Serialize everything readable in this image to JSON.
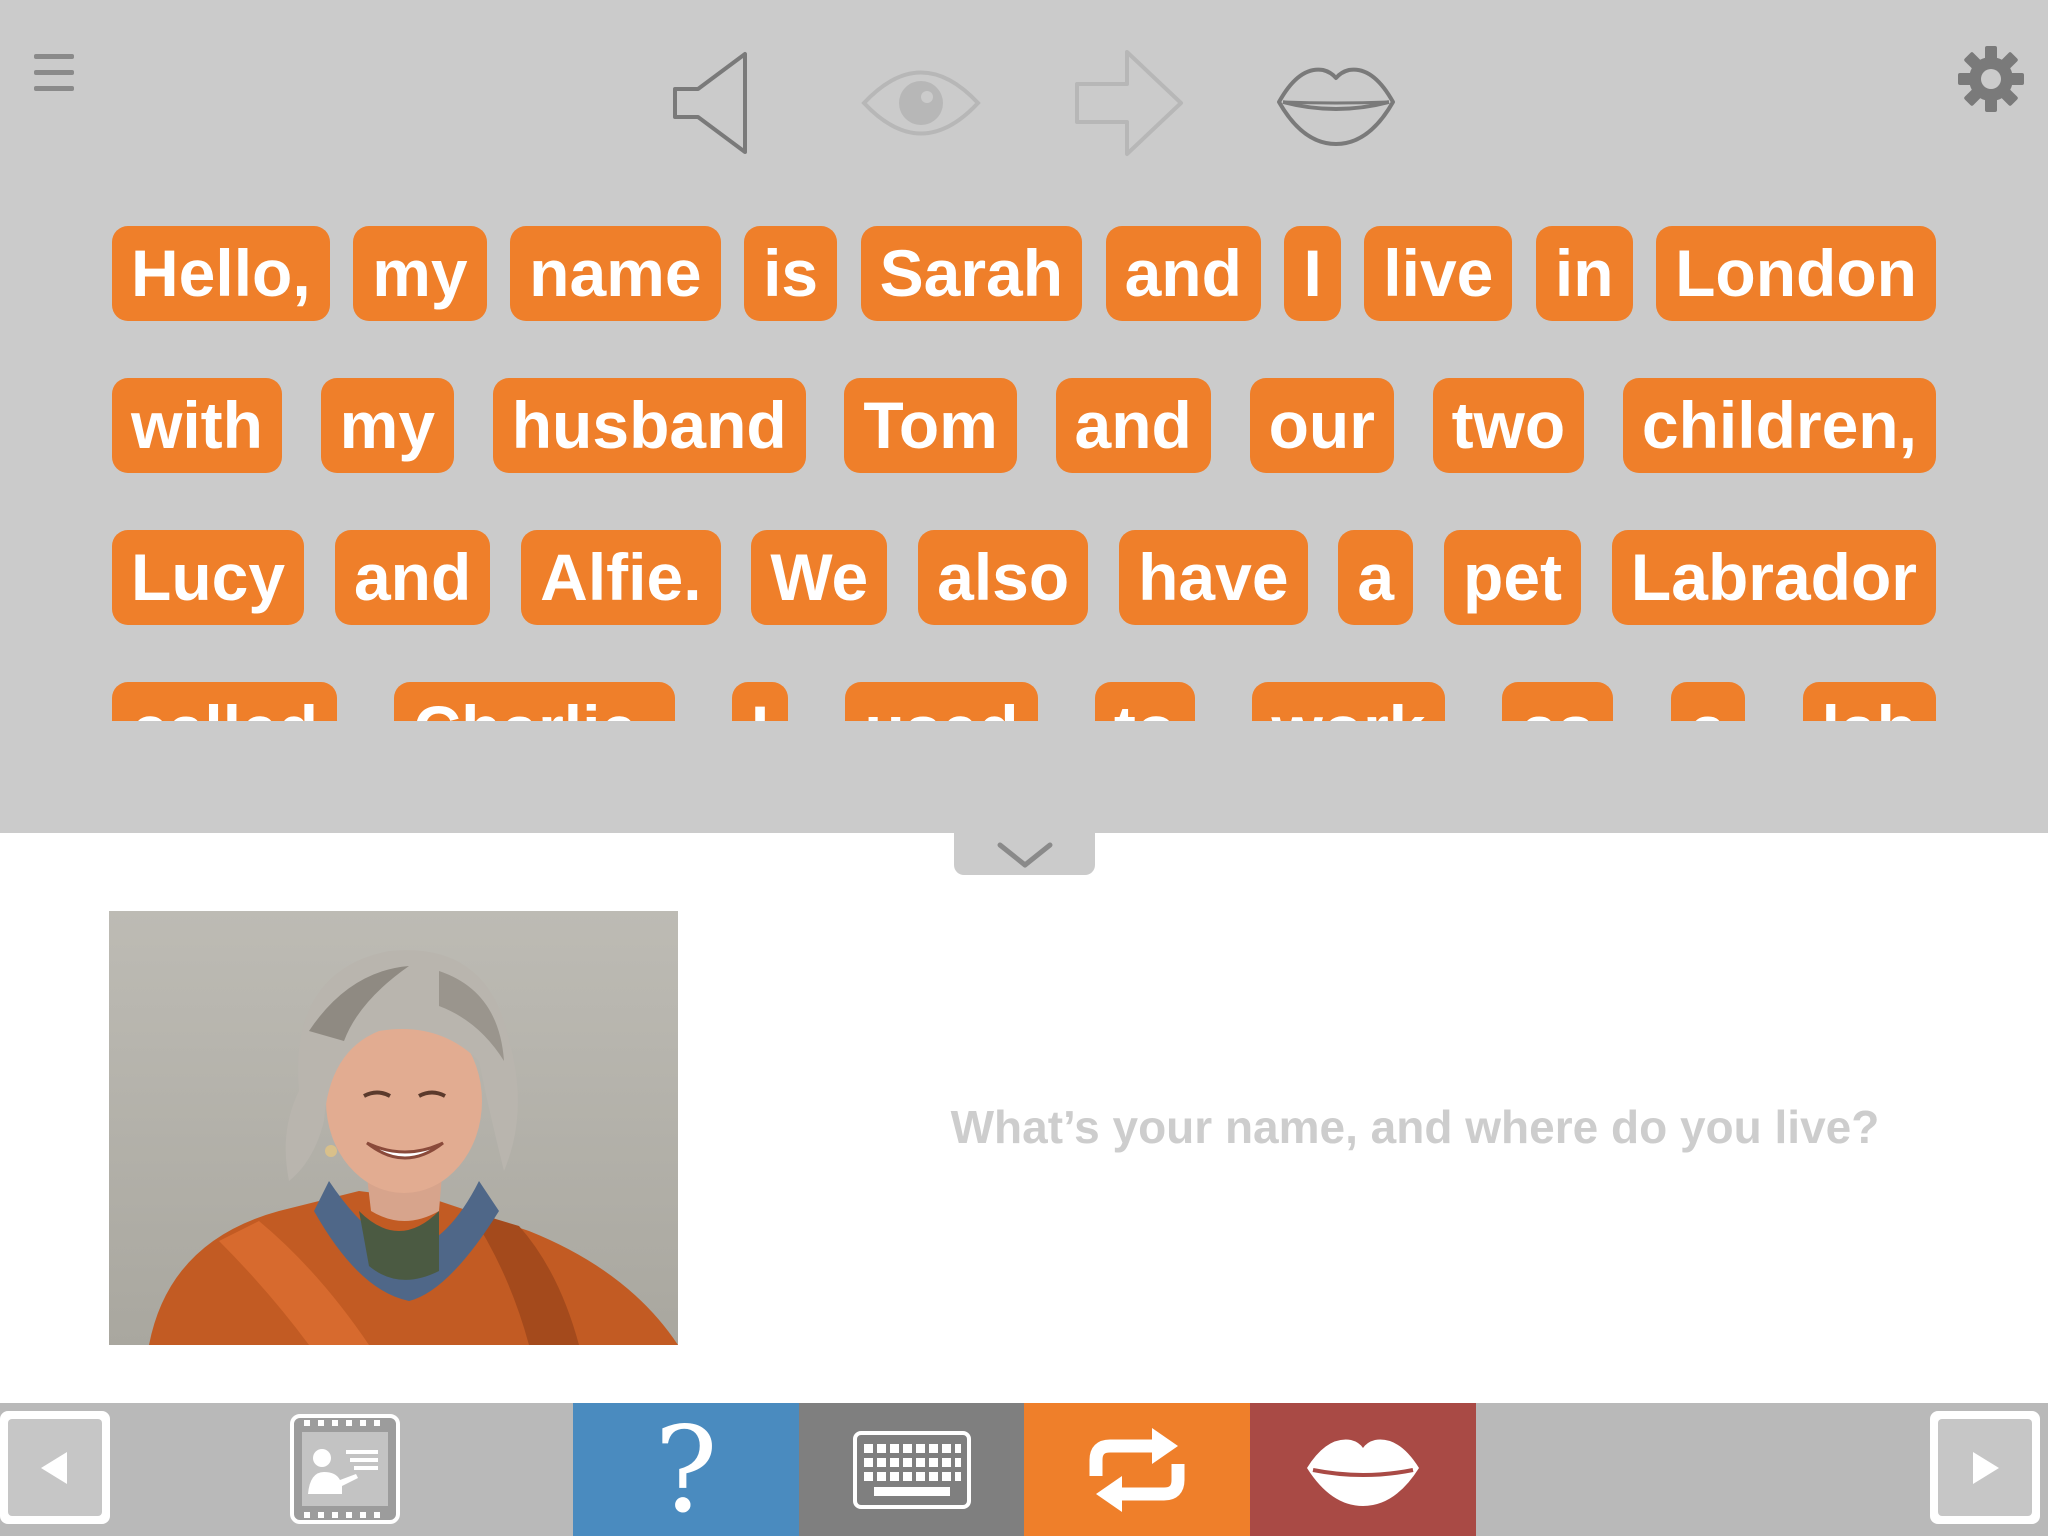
{
  "toolbar": {
    "menu_icon": "hamburger-menu-icon",
    "settings_icon": "gear-icon",
    "tools": [
      {
        "name": "speaker-icon",
        "state": "active"
      },
      {
        "name": "eye-icon",
        "state": "dimmed"
      },
      {
        "name": "arrow-right-icon",
        "state": "dimmed"
      },
      {
        "name": "lips-icon",
        "state": "active"
      }
    ]
  },
  "words": {
    "row1": [
      "Hello,",
      "my",
      "name",
      "is",
      "Sarah",
      "and",
      "I",
      "live",
      "in",
      "London"
    ],
    "row2": [
      "with",
      "my",
      "husband",
      "Tom",
      "and",
      "our",
      "two",
      "children,"
    ],
    "row3": [
      "Lucy",
      "and",
      "Alfie.",
      "We",
      "also",
      "have",
      "a",
      "pet",
      "Labrador"
    ],
    "row4": [
      "called",
      "Charlie.",
      "I",
      "used",
      "to",
      "work",
      "as",
      "a",
      "lab"
    ]
  },
  "content": {
    "photo_alt": "Portrait of a smiling woman with grey hair in an orange jacket",
    "prompt": "What’s your name, and where do you live?"
  },
  "bottom_bar": {
    "help_label": "?",
    "colors": {
      "help": "#4a8bbf",
      "keyboard": "#7f7f7f",
      "repeat": "#ef7f2a",
      "speak": "#a94a45"
    }
  },
  "colors": {
    "word_chip": "#ef7f2a",
    "top_panel": "#cbcbcb",
    "bottom_bar": "#b9b9b9"
  }
}
